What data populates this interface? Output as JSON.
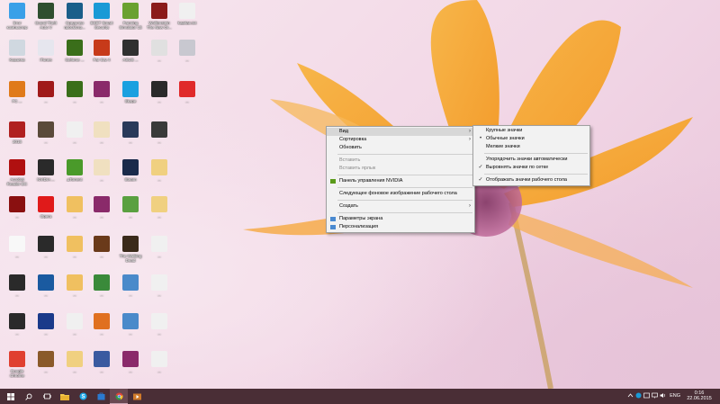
{
  "desktop_icons": [
    {
      "id": "i01",
      "label": "Этот компьютер",
      "icon": "computer-icon",
      "color": "#3aa0e8"
    },
    {
      "id": "i02",
      "label": "Grand Theft Auto V",
      "icon": "gta-icon",
      "color": "#2f4f2f"
    },
    {
      "id": "i03",
      "label": "Средство просмотр...",
      "icon": "photo-viewer-icon",
      "color": "#1b5e8a"
    },
    {
      "id": "i04",
      "label": "ESET Smart Security",
      "icon": "eset-icon",
      "color": "#1a9ad6"
    },
    {
      "id": "i05",
      "label": "Farming Simulator 15",
      "icon": "farming-icon",
      "color": "#6aa130"
    },
    {
      "id": "i06",
      "label": "Wolfenstein The New Or...",
      "icon": "wolfenstein-icon",
      "color": "#8b1a1a"
    },
    {
      "id": "i07",
      "label": "kapitan.txt",
      "icon": "text-file-icon",
      "color": "#f0f0f0"
    },
    {
      "id": "i08",
      "label": "Корзина",
      "icon": "recycle-bin-icon",
      "color": "#d0d8e0"
    },
    {
      "id": "i09",
      "label": "iTunes",
      "icon": "itunes-icon",
      "color": "#e6e6ee"
    },
    {
      "id": "i10",
      "label": "Geforce ...",
      "icon": "nvidia-icon",
      "color": "#3a6e1a"
    },
    {
      "id": "i11",
      "label": "Far Cry 4",
      "icon": "farcry-icon",
      "color": "#c73a1a"
    },
    {
      "id": "i12",
      "label": "ASUS ...",
      "icon": "asus-icon",
      "color": "#303030"
    },
    {
      "id": "i13",
      "label": "...",
      "icon": "document-icon",
      "color": "#e0e0e0"
    },
    {
      "id": "i14",
      "label": "...",
      "icon": "generic-file-icon",
      "color": "#c8c8d0"
    },
    {
      "id": "i15",
      "label": "FC ...",
      "icon": "fc-icon",
      "color": "#e07a1a"
    },
    {
      "id": "i16",
      "label": "...",
      "icon": "game-icon",
      "color": "#a01a1a"
    },
    {
      "id": "i17",
      "label": "...",
      "icon": "nvidia-icon",
      "color": "#3a6e1a"
    },
    {
      "id": "i18",
      "label": "...",
      "icon": "archive-icon",
      "color": "#8a2a6a"
    },
    {
      "id": "i19",
      "label": "Skype",
      "icon": "skype-icon",
      "color": "#1aa0e0"
    },
    {
      "id": "i20",
      "label": "...",
      "icon": "game-icon",
      "color": "#2a2a2a"
    },
    {
      "id": "i21",
      "label": "...",
      "icon": "pdf-icon",
      "color": "#e02a2a"
    },
    {
      "id": "i22",
      "label": "2016",
      "icon": "game-icon",
      "color": "#b02020"
    },
    {
      "id": "i23",
      "label": "...",
      "icon": "game-icon",
      "color": "#5a4a3a"
    },
    {
      "id": "i24",
      "label": "...",
      "icon": "pdf-icon",
      "color": "#f0f0f0"
    },
    {
      "id": "i25",
      "label": "...",
      "icon": "tv-icon",
      "color": "#f0e0c0"
    },
    {
      "id": "i26",
      "label": "...",
      "icon": "steam-icon",
      "color": "#2a3a5a"
    },
    {
      "id": "i27",
      "label": "...",
      "icon": "game-icon",
      "color": "#3a3a3a"
    },
    {
      "id": "i28",
      "label": "Acrobat Reader DC",
      "icon": "acrobat-icon",
      "color": "#b01010"
    },
    {
      "id": "i29",
      "label": "NVIDIA ...",
      "icon": "nvidia-icon",
      "color": "#2a2a2a"
    },
    {
      "id": "i30",
      "label": "µTorrent",
      "icon": "utorrent-icon",
      "color": "#4a9a2a"
    },
    {
      "id": "i31",
      "label": "...",
      "icon": "tv-icon",
      "color": "#f0e0c0"
    },
    {
      "id": "i32",
      "label": "Steam",
      "icon": "steam-icon",
      "color": "#1a2a4a"
    },
    {
      "id": "i33",
      "label": "...",
      "icon": "folder-icon",
      "color": "#f0d080"
    },
    {
      "id": "i34",
      "label": "...",
      "icon": "game-icon",
      "color": "#8a1010"
    },
    {
      "id": "i35",
      "label": "Opera",
      "icon": "opera-icon",
      "color": "#e01a1a"
    },
    {
      "id": "i36",
      "label": "...",
      "icon": "folder-icon",
      "color": "#f0c060"
    },
    {
      "id": "i37",
      "label": "...",
      "icon": "archive-icon",
      "color": "#8a2a6a"
    },
    {
      "id": "i38",
      "label": "...",
      "icon": "minecraft-icon",
      "color": "#5aa040"
    },
    {
      "id": "i39",
      "label": "...",
      "icon": "folder-icon",
      "color": "#f0d080"
    },
    {
      "id": "i40",
      "label": "...",
      "icon": "text-file-icon",
      "color": "#f8f8f8"
    },
    {
      "id": "i41",
      "label": "...",
      "icon": "nvidia-icon",
      "color": "#2a2a2a"
    },
    {
      "id": "i42",
      "label": "...",
      "icon": "folder-icon",
      "color": "#f0c060"
    },
    {
      "id": "i43",
      "label": "...",
      "icon": "game-icon",
      "color": "#6a3a1a"
    },
    {
      "id": "i44",
      "label": "The Walking Dead",
      "icon": "game-icon",
      "color": "#3a2a1a"
    },
    {
      "id": "i45",
      "label": "...",
      "icon": "text-file-icon",
      "color": "#f0f0f0"
    },
    {
      "id": "i46",
      "label": "...",
      "icon": "game-icon",
      "color": "#2a2a2a"
    },
    {
      "id": "i47",
      "label": "...",
      "icon": "r-icon",
      "color": "#1a5aa0"
    },
    {
      "id": "i48",
      "label": "...",
      "icon": "folder-icon",
      "color": "#f0c060"
    },
    {
      "id": "i49",
      "label": "...",
      "icon": "archive-icon",
      "color": "#3a8a3a"
    },
    {
      "id": "i50",
      "label": "...",
      "icon": "utorrent-icon",
      "color": "#4a8aca"
    },
    {
      "id": "i51",
      "label": "...",
      "icon": "text-file-icon",
      "color": "#f0f0f0"
    },
    {
      "id": "i52",
      "label": "...",
      "icon": "nvidia-icon",
      "color": "#2a2a2a"
    },
    {
      "id": "i53",
      "label": "...",
      "icon": "game-icon",
      "color": "#1a3a8a"
    },
    {
      "id": "i54",
      "label": "...",
      "icon": "folder-icon",
      "color": "#f0f0f0"
    },
    {
      "id": "i55",
      "label": "...",
      "icon": "origin-icon",
      "color": "#e07020"
    },
    {
      "id": "i56",
      "label": "...",
      "icon": "utorrent-icon",
      "color": "#4a8aca"
    },
    {
      "id": "i57",
      "label": "...",
      "icon": "text-file-icon",
      "color": "#f0f0f0"
    },
    {
      "id": "i58",
      "label": "Google Chrome",
      "icon": "chrome-icon",
      "color": "#e04030"
    },
    {
      "id": "i59",
      "label": "...",
      "icon": "game-icon",
      "color": "#8a5a2a"
    },
    {
      "id": "i60",
      "label": "...",
      "icon": "folder-icon",
      "color": "#f0d080"
    },
    {
      "id": "i61",
      "label": "...",
      "icon": "network-icon",
      "color": "#3a5aa0"
    },
    {
      "id": "i62",
      "label": "...",
      "icon": "archive-icon",
      "color": "#8a2a6a"
    },
    {
      "id": "i63",
      "label": "...",
      "icon": "text-file-icon",
      "color": "#f0f0f0"
    }
  ],
  "context_menu": {
    "items": [
      {
        "type": "item",
        "label": "Вид",
        "submenu": true,
        "highlighted": true
      },
      {
        "type": "item",
        "label": "Сортировка",
        "submenu": true
      },
      {
        "type": "item",
        "label": "Обновить"
      },
      {
        "type": "sep"
      },
      {
        "type": "item",
        "label": "Вставить",
        "disabled": true
      },
      {
        "type": "item",
        "label": "Вставить ярлык",
        "disabled": true
      },
      {
        "type": "sep"
      },
      {
        "type": "item",
        "label": "Панель управления NVIDIA",
        "icon": "nvidia-icon"
      },
      {
        "type": "sep"
      },
      {
        "type": "item",
        "label": "Следующее фоновое изображение рабочего стола"
      },
      {
        "type": "sep"
      },
      {
        "type": "item",
        "label": "Создать",
        "submenu": true
      },
      {
        "type": "sep"
      },
      {
        "type": "item",
        "label": "Параметры экрана",
        "icon": "display-icon"
      },
      {
        "type": "item",
        "label": "Персонализация",
        "icon": "personalize-icon"
      }
    ]
  },
  "view_submenu": {
    "items": [
      {
        "type": "item",
        "label": "Крупные значки"
      },
      {
        "type": "item",
        "label": "Обычные значки",
        "mark": "•"
      },
      {
        "type": "item",
        "label": "Мелкие значки"
      },
      {
        "type": "sep"
      },
      {
        "type": "item",
        "label": "Упорядочить значки автоматически"
      },
      {
        "type": "item",
        "label": "Выровнять значки по сетке",
        "mark": "✓"
      },
      {
        "type": "sep"
      },
      {
        "type": "item",
        "label": "Отображать значки рабочего стола",
        "mark": "✓"
      }
    ]
  },
  "taskbar": {
    "buttons": [
      {
        "name": "start-button",
        "icon": "windows-icon"
      },
      {
        "name": "search-button",
        "icon": "search-icon"
      },
      {
        "name": "task-view-button",
        "icon": "task-view-icon"
      },
      {
        "name": "taskbar-explorer",
        "icon": "folder-icon"
      },
      {
        "name": "taskbar-skype",
        "icon": "skype-icon"
      },
      {
        "name": "taskbar-store",
        "icon": "store-icon"
      },
      {
        "name": "taskbar-chrome",
        "icon": "chrome-icon"
      },
      {
        "name": "taskbar-media",
        "icon": "media-icon"
      }
    ],
    "lang": "ENG",
    "time": "0:16",
    "date": "22.06.2015"
  }
}
